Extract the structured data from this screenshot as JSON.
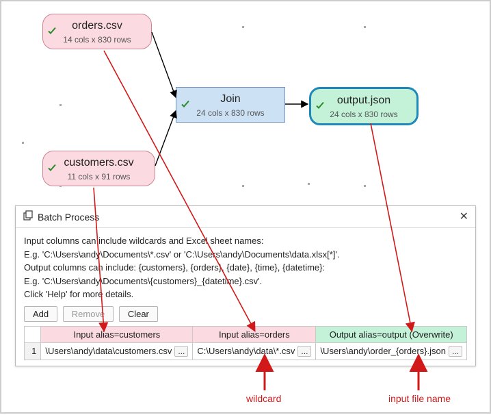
{
  "nodes": {
    "orders": {
      "title": "orders.csv",
      "sub": "14 cols x 830 rows"
    },
    "customers": {
      "title": "customers.csv",
      "sub": "11 cols x 91 rows"
    },
    "join": {
      "title": "Join",
      "sub": "24 cols x 830 rows"
    },
    "output": {
      "title": "output.json",
      "sub": "24 cols x 830 rows"
    }
  },
  "panel": {
    "title": "Batch Process",
    "help1": "Input columns can include wildcards and Excel sheet names:",
    "help2": "E.g. 'C:\\Users\\andy\\Documents\\*.csv' or 'C:\\Users\\andy\\Documents\\data.xlsx[*]'.",
    "help3": "Output columns can include: {customers}, {orders}, {date}, {time}, {datetime}:",
    "help4": "E.g. 'C:\\Users\\andy\\Documents\\{customers}_{datetime}.csv'.",
    "help5": "Click 'Help' for more details.",
    "btn_add": "Add",
    "btn_remove": "Remove",
    "btn_clear": "Clear",
    "col0": "Input alias=customers",
    "col1": "Input alias=orders",
    "col2": "Output alias=output (Overwrite)",
    "row": {
      "num": "1",
      "c0": "\\Users\\andy\\data\\customers.csv",
      "c1": "C:\\Users\\andy\\data\\*.csv",
      "c2": "\\Users\\andy\\order_{orders}.json"
    },
    "more": "..."
  },
  "annotations": {
    "wildcard": "wildcard",
    "inputfile": "input file name"
  }
}
